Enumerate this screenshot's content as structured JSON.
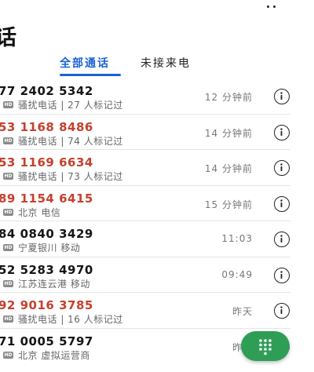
{
  "header": {
    "title": "话"
  },
  "tabs": [
    {
      "label": "全部通话",
      "active": true
    },
    {
      "label": "未接来电",
      "active": false
    }
  ],
  "calls": [
    {
      "number": "77 2402 5342",
      "tag": "HD",
      "detail": "骚扰电话 | 27 人标记过",
      "time": "12 分钟前",
      "missed": false
    },
    {
      "number": "53 1168 8486",
      "tag": "HD",
      "detail": "骚扰电话 | 74 人标记过",
      "time": "14 分钟前",
      "missed": true
    },
    {
      "number": "53 1169 6634",
      "tag": "HD",
      "detail": "骚扰电话 | 73 人标记过",
      "time": "14 分钟前",
      "missed": true
    },
    {
      "number": "89 1154 6415",
      "tag": "HD",
      "detail": "北京 电信",
      "time": "15 分钟前",
      "missed": true
    },
    {
      "number": "84 0840 3429",
      "tag": "HD",
      "detail": "宁夏银川 移动",
      "time": "11:03",
      "missed": false
    },
    {
      "number": "52 5283 4970",
      "tag": "HD",
      "detail": "江苏连云港 移动",
      "time": "09:49",
      "missed": false
    },
    {
      "number": "92 9016 3785",
      "tag": "HD",
      "detail": "骚扰电话 | 16 人标记过",
      "time": "昨天",
      "missed": true
    },
    {
      "number": "71 0005 5797",
      "tag": "HD",
      "detail": "北京 虚拟运营商",
      "time": "昨天",
      "missed": false
    }
  ],
  "icons": {
    "more": "more-vertical-icon",
    "info": "info-icon",
    "dialpad": "dialpad-icon"
  },
  "colors": {
    "accent": "#1a62d6",
    "missed": "#c6402e",
    "fab": "#2e9e57"
  }
}
